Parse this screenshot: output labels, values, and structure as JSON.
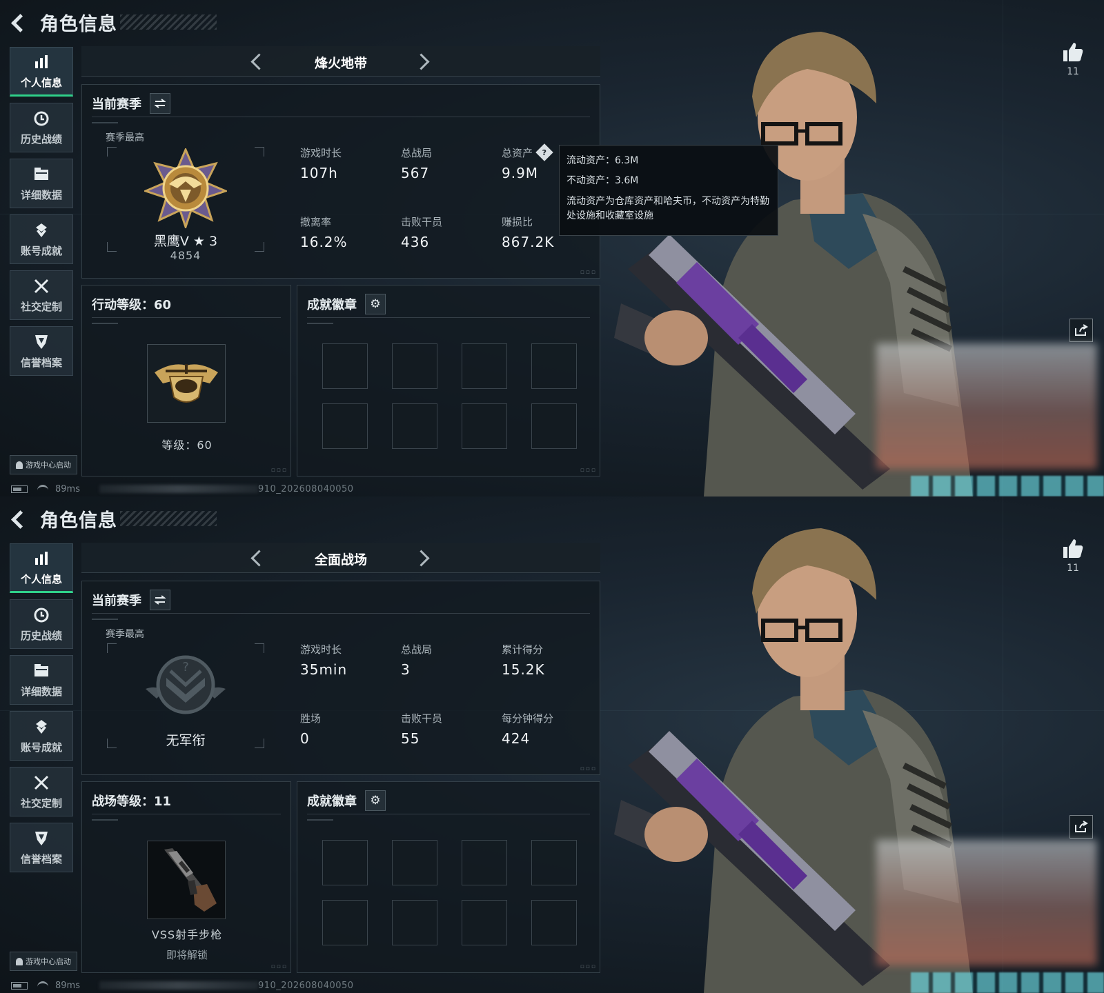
{
  "screens": [
    {
      "header": {
        "title": "角色信息"
      },
      "sidebar": {
        "items": [
          {
            "label": "个人信息",
            "icon": "bar-chart-icon",
            "active": true
          },
          {
            "label": "历史战绩",
            "icon": "history-clock-icon"
          },
          {
            "label": "详细数据",
            "icon": "folder-icon"
          },
          {
            "label": "账号成就",
            "icon": "achievement-icon"
          },
          {
            "label": "社交定制",
            "icon": "tools-icon"
          },
          {
            "label": "信誉档案",
            "icon": "shield-icon"
          }
        ]
      },
      "launch_chip": "游戏中心启动",
      "status": {
        "ping": "89ms",
        "uid_suffix": "910_202608040050"
      },
      "mode": {
        "title": "烽火地带"
      },
      "season": {
        "title": "当前赛季",
        "best_label": "赛季最高",
        "rank_name": "黑鹰V ★ 3",
        "rank_score": "4854",
        "stats": [
          {
            "label": "游戏时长",
            "value": "107h"
          },
          {
            "label": "总战局",
            "value": "567"
          },
          {
            "label": "总资产",
            "value": "9.9M",
            "help": true
          },
          {
            "label": "撤离率",
            "value": "16.2%"
          },
          {
            "label": "击败干员",
            "value": "436"
          },
          {
            "label": "赚损比",
            "value": "867.2K"
          }
        ]
      },
      "tooltip": {
        "line1": "流动资产：6.3M",
        "line2": "不动资产：3.6M",
        "desc": "流动资产为仓库资产和哈夫币，不动资产为特勤处设施和收藏室设施"
      },
      "level": {
        "title": "行动等级：60",
        "text": "等级：60"
      },
      "badges": {
        "title": "成就徽章"
      },
      "likes": "11"
    },
    {
      "header": {
        "title": "角色信息"
      },
      "sidebar": {
        "items": [
          {
            "label": "个人信息",
            "icon": "bar-chart-icon",
            "active": true
          },
          {
            "label": "历史战绩",
            "icon": "history-clock-icon"
          },
          {
            "label": "详细数据",
            "icon": "folder-icon"
          },
          {
            "label": "账号成就",
            "icon": "achievement-icon"
          },
          {
            "label": "社交定制",
            "icon": "tools-icon"
          },
          {
            "label": "信誉档案",
            "icon": "shield-icon"
          }
        ]
      },
      "launch_chip": "游戏中心启动",
      "status": {
        "ping": "89ms",
        "uid_suffix": "910_202608040050"
      },
      "mode": {
        "title": "全面战场"
      },
      "season": {
        "title": "当前赛季",
        "best_label": "赛季最高",
        "rank_name": "无军衔",
        "stats": [
          {
            "label": "游戏时长",
            "value": "35min"
          },
          {
            "label": "总战局",
            "value": "3"
          },
          {
            "label": "累计得分",
            "value": "15.2K"
          },
          {
            "label": "胜场",
            "value": "0"
          },
          {
            "label": "击败干员",
            "value": "55"
          },
          {
            "label": "每分钟得分",
            "value": "424"
          }
        ]
      },
      "level": {
        "title": "战场等级：11",
        "text": "VSS射手步枪",
        "sub": "即将解锁"
      },
      "badges": {
        "title": "成就徽章"
      },
      "likes": "11"
    }
  ],
  "colors": {
    "accent_active": "#2fd18a",
    "panel_bg": "#121a20",
    "page_bg": "#0f161c"
  }
}
